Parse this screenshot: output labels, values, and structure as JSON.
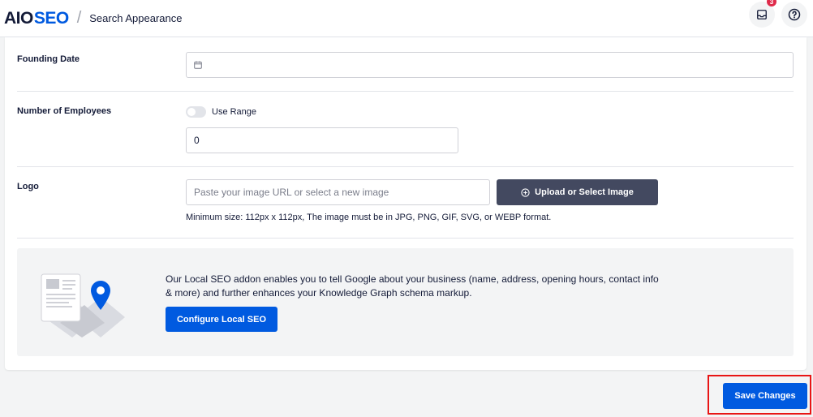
{
  "header": {
    "logo_aio": "AIO",
    "logo_seo": "SEO",
    "separator": "/",
    "breadcrumb": "Search Appearance",
    "notification_count": "3",
    "inbox_icon": "inbox-icon",
    "help_icon": "help-icon"
  },
  "founding_date": {
    "label": "Founding Date",
    "value": "",
    "icon": "calendar-icon"
  },
  "employees": {
    "label": "Number of Employees",
    "toggle_label": "Use Range",
    "toggle_on": false,
    "value": "0"
  },
  "logo_field": {
    "label": "Logo",
    "placeholder": "Paste your image URL or select a new image",
    "upload_label": "Upload or Select Image",
    "hint": "Minimum size: 112px x 112px, The image must be in JPG, PNG, GIF, SVG, or WEBP format."
  },
  "promo": {
    "text": "Our Local SEO addon enables you to tell Google about your business (name, address, opening hours, contact info & more) and further enhances your Knowledge Graph schema markup.",
    "button_label": "Configure Local SEO"
  },
  "footer": {
    "save_label": "Save Changes"
  },
  "colors": {
    "brand_blue": "#005ae0",
    "dark_button": "#434960",
    "highlight_red": "#e81515",
    "badge_red": "#df2a4a"
  }
}
